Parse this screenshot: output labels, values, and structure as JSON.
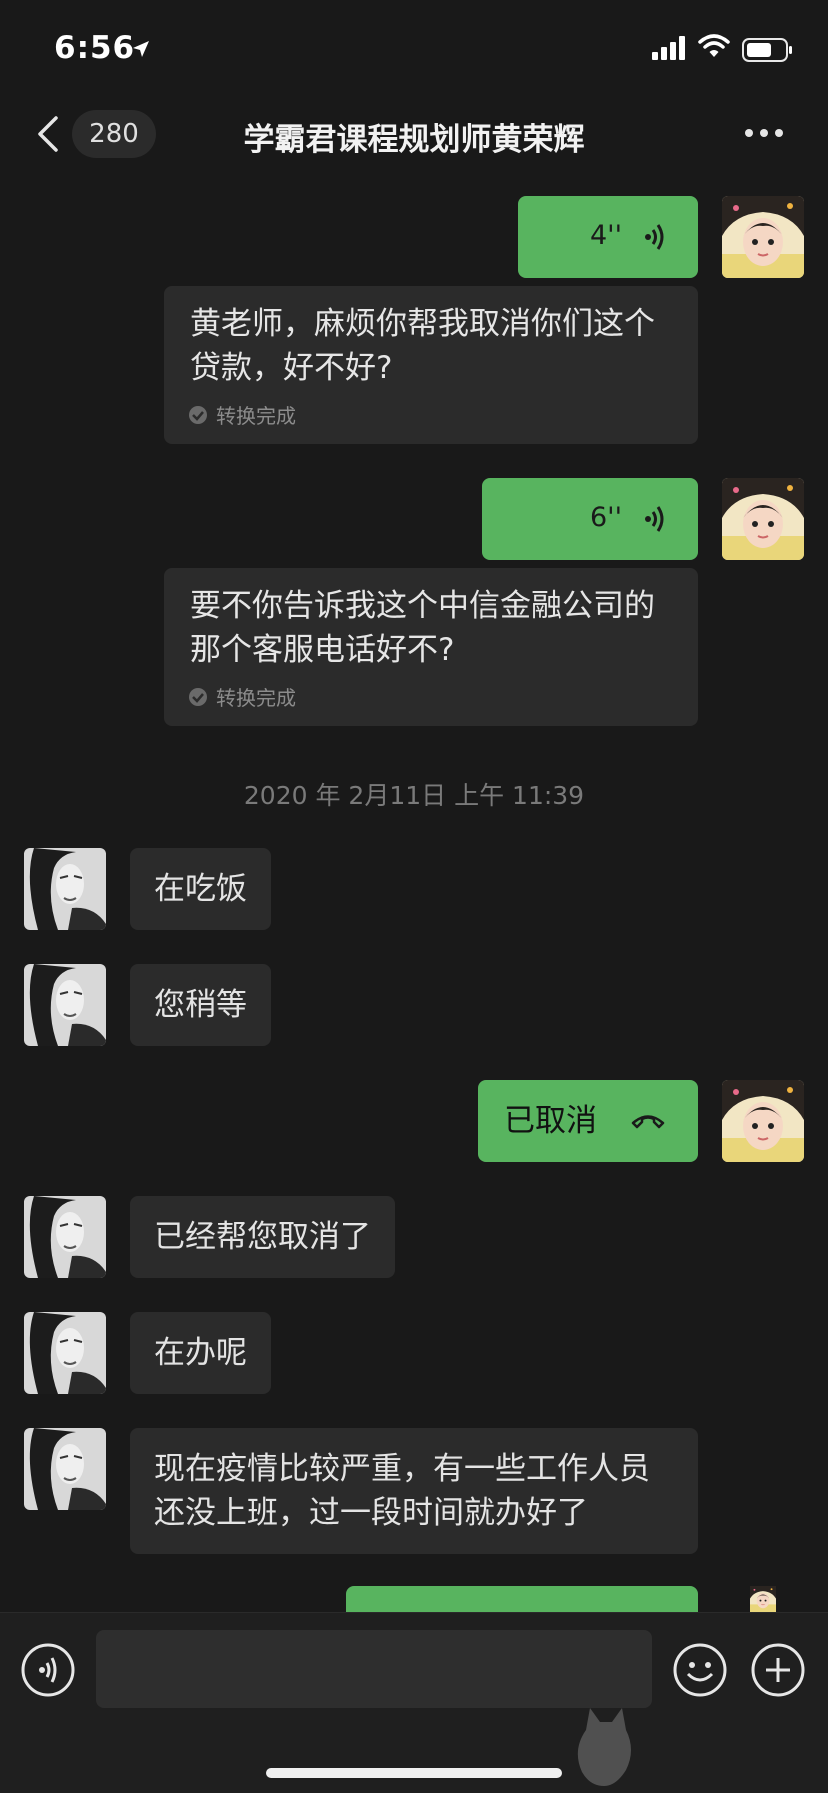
{
  "status_bar": {
    "time": "6:56"
  },
  "nav": {
    "unread_count": "280",
    "title": "学霸君课程规划师黄荣辉"
  },
  "messages": {
    "voice1": {
      "duration": "4''",
      "transcript": "黄老师，麻烦你帮我取消你们这个贷款，好不好?",
      "status": "转换完成"
    },
    "voice2": {
      "duration": "6''",
      "transcript": "要不你告诉我这个中信金融公司的那个客服电话好不?",
      "status": "转换完成"
    },
    "timestamp": "2020 年 2月11日 上午 11:39",
    "in1": "在吃饭",
    "in2": "您稍等",
    "call": "已取消",
    "in3": "已经帮您取消了",
    "in4": "在办呢",
    "in5": "现在疫情比较严重，有一些工作人员还没上班，过一段时间就办好了"
  },
  "colors": {
    "background": "#191919",
    "sent_bubble": "#58b45f",
    "received_bubble": "#2b2b2b"
  },
  "icons": [
    "location-arrow-icon",
    "signal-icon",
    "wifi-icon",
    "battery-icon",
    "back-chevron-icon",
    "more-icon",
    "voice-wave-icon",
    "check-icon",
    "hangup-icon",
    "voice-input-icon",
    "emoji-icon",
    "plus-icon"
  ]
}
